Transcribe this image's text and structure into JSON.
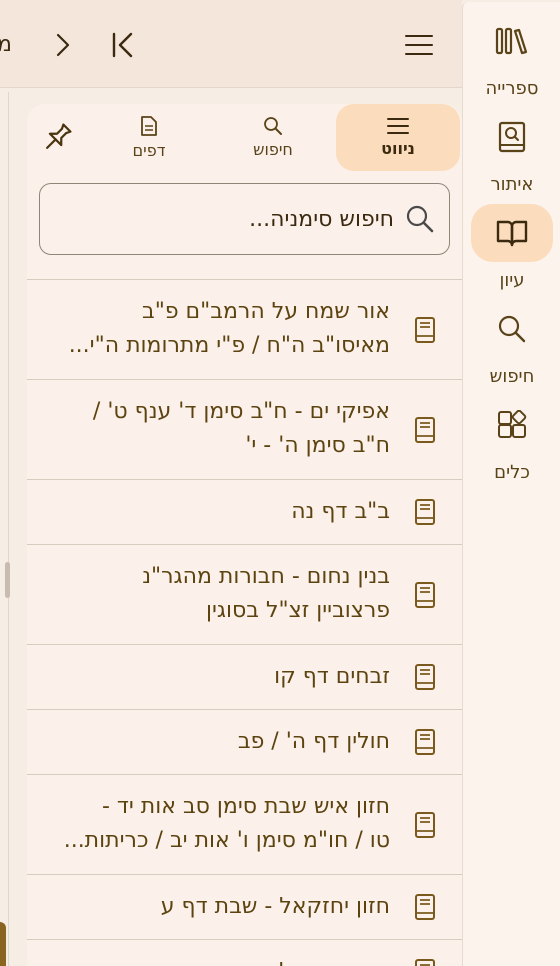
{
  "topbar": {
    "title": "מ"
  },
  "rail": {
    "items": [
      {
        "label": "ספרייה",
        "icon": "library-icon",
        "active": false
      },
      {
        "label": "איתור",
        "icon": "find-book-icon",
        "active": false
      },
      {
        "label": "עיון",
        "icon": "open-book-icon",
        "active": true
      },
      {
        "label": "חיפוש",
        "icon": "search-icon",
        "active": false
      },
      {
        "label": "כלים",
        "icon": "tools-icon",
        "active": false
      }
    ]
  },
  "panel": {
    "tabs": [
      {
        "label": "ניווט",
        "icon": "menu-icon",
        "active": true
      },
      {
        "label": "חיפוש",
        "icon": "search-icon",
        "active": false
      },
      {
        "label": "דפים",
        "icon": "pages-icon",
        "active": false
      }
    ],
    "search_placeholder": "חיפוש סימניה...",
    "bookmarks": [
      {
        "line1": "אור שמח על הרמב\"ם פ\"ב",
        "line2": "מאיסו\"ב ה\"ח / פ\"י מתרומות ה\"י..."
      },
      {
        "line1": "אפיקי ים - ח\"ב סימן ד' ענף ט' /",
        "line2": "ח\"ב סימן ה' - י'"
      },
      {
        "line1": "ב\"ב דף נה",
        "line2": ""
      },
      {
        "line1": "בנין נחום - חבורות מהגר\"נ",
        "line2": "פרצוביין זצ\"ל בסוגין"
      },
      {
        "line1": "זבחים דף קו",
        "line2": ""
      },
      {
        "line1": "חולין דף ה' / פב",
        "line2": ""
      },
      {
        "line1": "חזון איש שבת סימן סב אות יד -",
        "line2": "טו / חו\"מ סימן ו' אות יב / כריתות..."
      },
      {
        "line1": "חזון יחזקאל - שבת דף ע",
        "line2": ""
      },
      {
        "line1": "חזון יחזקאל - תוספתא",
        "line2": ""
      }
    ]
  },
  "colors": {
    "accent": "#fbdcbc",
    "text": "#5c4310",
    "background": "#f6ede4"
  }
}
